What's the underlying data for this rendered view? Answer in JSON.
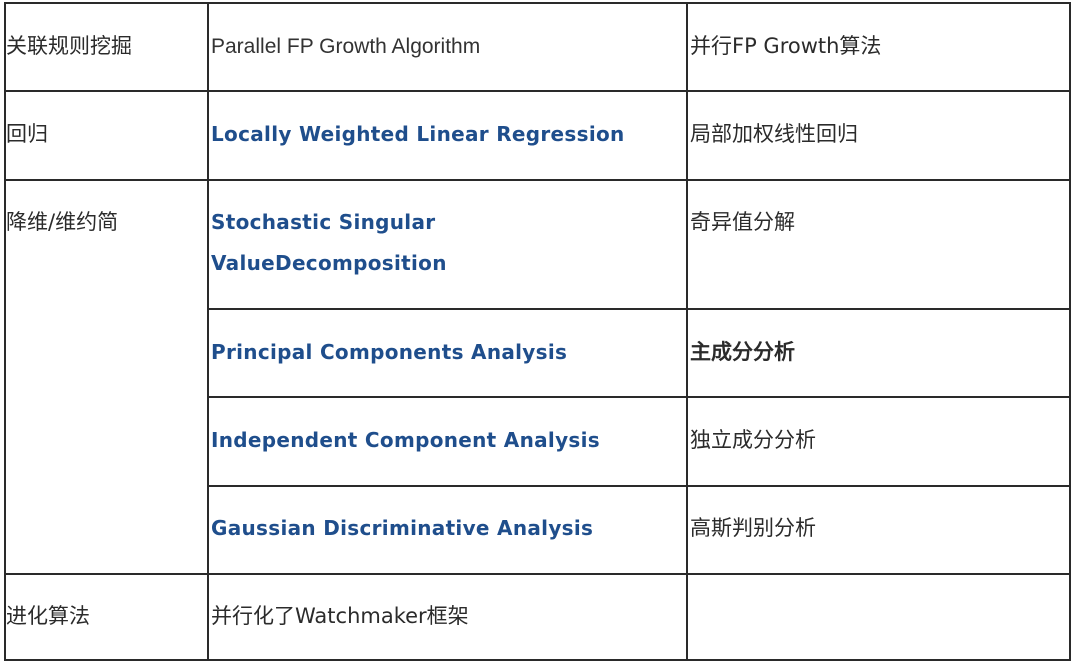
{
  "rows": [
    {
      "category": "关联规则挖掘",
      "algorithm": "Parallel FP Growth Algorithm",
      "chinese": "并行FP Growth算法"
    },
    {
      "category": "回归",
      "algorithm": "Locally Weighted Linear Regression",
      "chinese": "局部加权线性回归"
    },
    {
      "category": "降维/维约简",
      "algorithm_line1": "Stochastic Singular",
      "algorithm_line2": "ValueDecomposition",
      "chinese": "奇异值分解"
    },
    {
      "algorithm": "Principal Components Analysis",
      "chinese": "主成分分析"
    },
    {
      "algorithm": "Independent Component Analysis",
      "chinese": "独立成分分析"
    },
    {
      "algorithm": "Gaussian Discriminative Analysis",
      "chinese": "高斯判别分析"
    },
    {
      "category": "进化算法",
      "algorithm": "并行化了Watchmaker框架",
      "chinese": ""
    }
  ]
}
